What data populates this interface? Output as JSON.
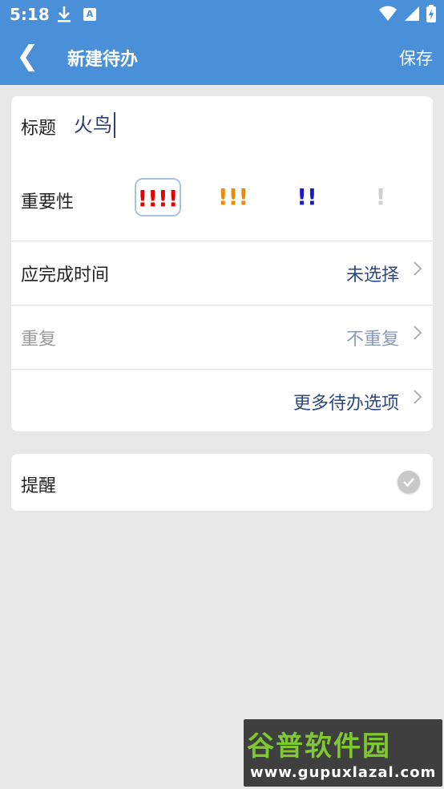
{
  "status_bar": {
    "time": "5:18",
    "download_icon": "download-icon",
    "a_icon_label": "A"
  },
  "app_bar": {
    "back_glyph": "❮",
    "title": "新建待办",
    "save_label": "保存"
  },
  "form": {
    "title_label": "标题",
    "title_value": "火鸟",
    "priority_label": "重要性",
    "priorities": [
      {
        "text": "!!!!",
        "color": "#e60000",
        "selected": true
      },
      {
        "text": "!!!",
        "color": "#f08a00",
        "selected": false
      },
      {
        "text": "!!",
        "color": "#1a1acc",
        "selected": false
      },
      {
        "text": "!",
        "color": "#cfcfcf",
        "selected": false
      }
    ],
    "due_label": "应完成时间",
    "due_value": "未选择",
    "repeat_label": "重复",
    "repeat_value": "不重复",
    "more_label": "更多待办选项"
  },
  "reminder": {
    "label": "提醒",
    "checked": true
  },
  "watermark": {
    "top_text": "谷普软件园",
    "bottom_text": "www.gupuxlazal.com"
  },
  "colors": {
    "accent": "#4a90d9",
    "value_text": "#2e4a82"
  }
}
